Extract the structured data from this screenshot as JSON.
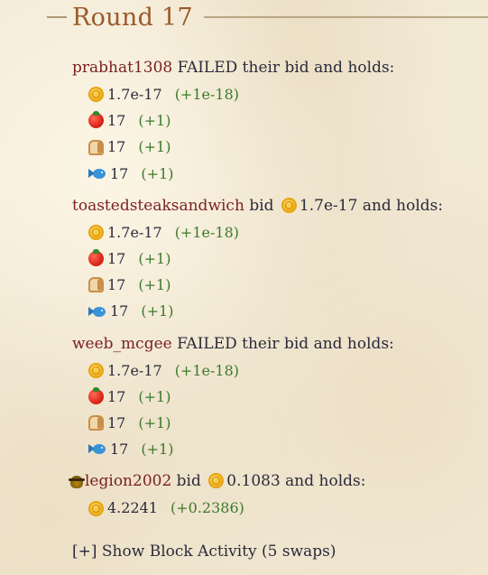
{
  "round": {
    "title": "Round 17"
  },
  "players": [
    {
      "name": "prabhat1308",
      "action_text": "FAILED their bid and holds:",
      "bid_amount": null,
      "badge": false,
      "holdings": [
        {
          "icon": "coin-icon",
          "amount": "1.7e-17",
          "delta": "(+1e-18)"
        },
        {
          "icon": "tomato-icon",
          "amount": "17",
          "delta": "(+1)"
        },
        {
          "icon": "bread-icon",
          "amount": "17",
          "delta": "(+1)"
        },
        {
          "icon": "fish-icon",
          "amount": "17",
          "delta": "(+1)"
        }
      ]
    },
    {
      "name": "toastedsteaksandwich",
      "action_text": "bid",
      "bid_amount": "1.7e-17",
      "after_bid_text": "and holds:",
      "badge": false,
      "holdings": [
        {
          "icon": "coin-icon",
          "amount": "1.7e-17",
          "delta": "(+1e-18)"
        },
        {
          "icon": "tomato-icon",
          "amount": "17",
          "delta": "(+1)"
        },
        {
          "icon": "bread-icon",
          "amount": "17",
          "delta": "(+1)"
        },
        {
          "icon": "fish-icon",
          "amount": "17",
          "delta": "(+1)"
        }
      ]
    },
    {
      "name": "weeb_mcgee",
      "action_text": "FAILED their bid and holds:",
      "bid_amount": null,
      "badge": false,
      "holdings": [
        {
          "icon": "coin-icon",
          "amount": "1.7e-17",
          "delta": "(+1e-18)"
        },
        {
          "icon": "tomato-icon",
          "amount": "17",
          "delta": "(+1)"
        },
        {
          "icon": "bread-icon",
          "amount": "17",
          "delta": "(+1)"
        },
        {
          "icon": "fish-icon",
          "amount": "17",
          "delta": "(+1)"
        }
      ]
    },
    {
      "name": "legion2002",
      "action_text": "bid",
      "bid_amount": "0.1083",
      "after_bid_text": "and holds:",
      "badge": true,
      "holdings": [
        {
          "icon": "coin-icon",
          "amount": "4.2241",
          "delta": "(+0.2386)"
        }
      ]
    }
  ],
  "block_activity": {
    "label": "[+] Show Block Activity (5 swaps)"
  },
  "colors": {
    "player_name": "#7a1f1f",
    "delta": "#3c7a2a",
    "title": "#9b5a2a",
    "text": "#2a2a3a"
  }
}
